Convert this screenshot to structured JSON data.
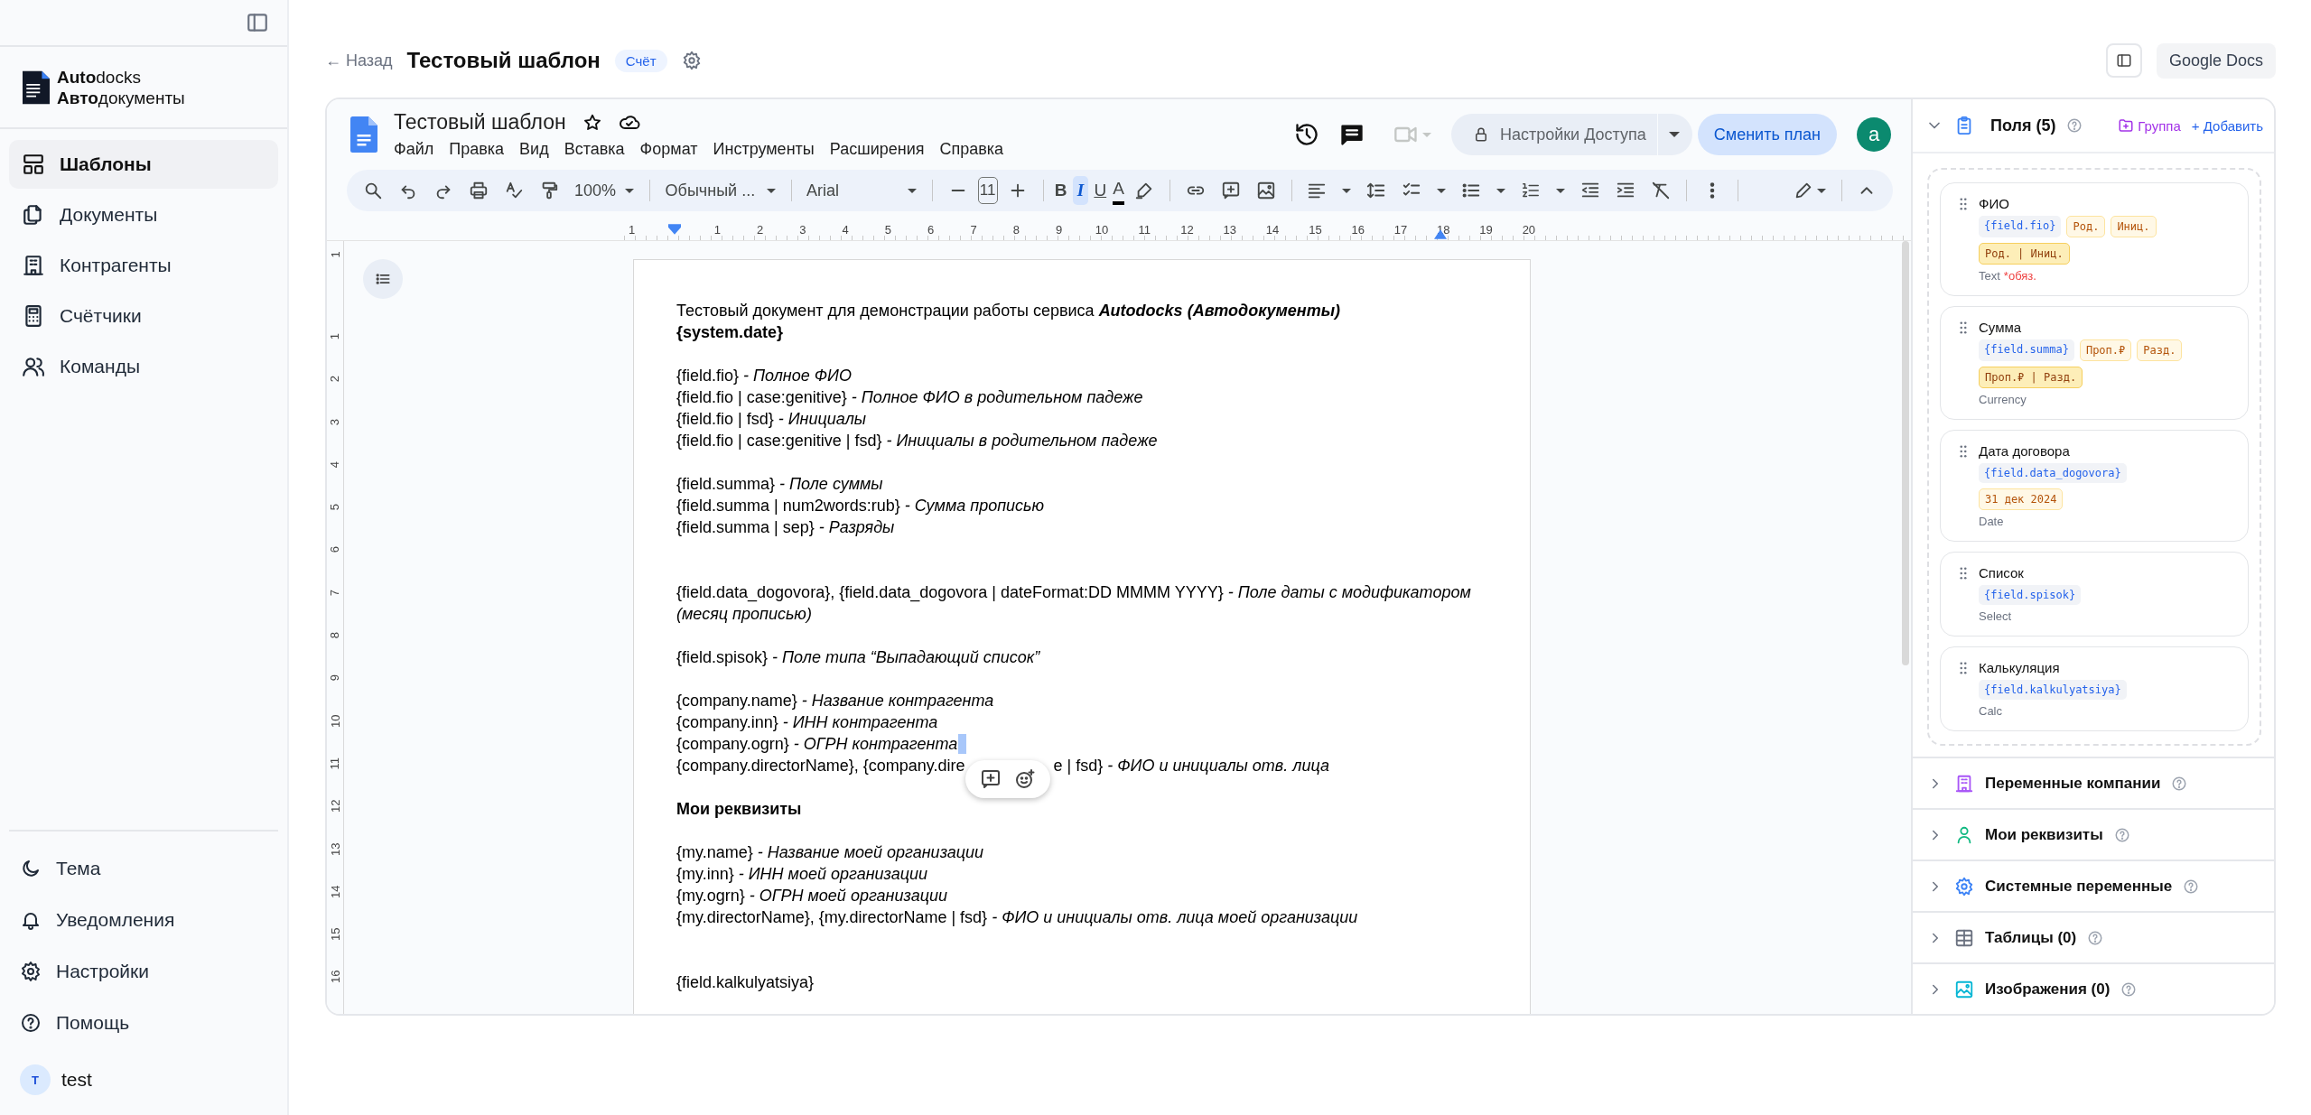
{
  "sidebar": {
    "brand": {
      "line_1": "**Auto**docks",
      "line_2": "**Авто**документы"
    },
    "nav": [
      {
        "label": "Шаблоны",
        "selected": true
      },
      {
        "label": "Документы",
        "selected": false
      },
      {
        "label": "Контрагенты",
        "selected": false
      },
      {
        "label": "Счётчики",
        "selected": false
      },
      {
        "label": "Команды",
        "selected": false
      }
    ],
    "footer": [
      {
        "label": "Тема"
      },
      {
        "label": "Уведомления"
      },
      {
        "label": "Настройки"
      },
      {
        "label": "Помощь"
      }
    ],
    "user": {
      "initial": "T",
      "name": "test"
    }
  },
  "header": {
    "back": "← Назад",
    "title": "Тестовый шаблон",
    "badge": "Счёт",
    "google_docs_button": "Google Docs"
  },
  "docs": {
    "title": "Тестовый шаблон",
    "menu": [
      "Файл",
      "Правка",
      "Вид",
      "Вставка",
      "Формат",
      "Инструменты",
      "Расширения",
      "Справка"
    ],
    "share_button": "Настройки Доступа",
    "plan_button": "Сменить план",
    "avatar": "a",
    "toolbar": {
      "zoom": "100%",
      "style": "Обычный ...",
      "font": "Arial",
      "font_size": "11",
      "format_buttons": [
        {
          "label": "B",
          "selected": false
        },
        {
          "label": "I",
          "selected": true
        },
        {
          "label": "U",
          "selected": false
        },
        {
          "label": "A",
          "selected": false
        }
      ]
    },
    "ruler_h": [
      "1",
      "1",
      "2",
      "3",
      "4",
      "5",
      "6",
      "7",
      "8",
      "9",
      "10",
      "11",
      "12",
      "13",
      "14",
      "15",
      "16",
      "17",
      "18",
      "19",
      "20"
    ],
    "ruler_v": [
      "1",
      "1",
      "2",
      "3",
      "4",
      "5",
      "6",
      "7",
      "8",
      "9",
      "10",
      "11",
      "12",
      "13",
      "14",
      "15",
      "16"
    ],
    "document": [
      {
        "kind": "intro",
        "text": "Тестовый документ для демонстрации работы сервиса *Autodocks (Автодокументы)*"
      },
      {
        "kind": "bold",
        "text": "{system.date}"
      },
      {
        "kind": "blank"
      },
      {
        "kind": "text",
        "text": "{field.fio} *- Полное ФИО*"
      },
      {
        "kind": "text",
        "text": "{field.fio | case:genitive} *- Полное ФИО в родительном падеже*"
      },
      {
        "kind": "text",
        "text": "{field.fio | fsd} *- Инициалы*"
      },
      {
        "kind": "text",
        "text": "{field.fio | case:genitive | fsd} *- Инициалы в родительном падеже*"
      },
      {
        "kind": "blank"
      },
      {
        "kind": "text",
        "text": "{field.summa} *- Поле суммы*"
      },
      {
        "kind": "text",
        "text": "{field.summa | num2words:rub} *- Сумма прописью*"
      },
      {
        "kind": "text",
        "text": "{field.summa | sep} *- Разряды*"
      },
      {
        "kind": "blank"
      },
      {
        "kind": "blank"
      },
      {
        "kind": "text",
        "text": "{field.data_dogovora}, {field.data_dogovora | dateFormat:DD MMMM YYYY} *- Поле даты с модификатором (месяц прописью)*"
      },
      {
        "kind": "blank"
      },
      {
        "kind": "text",
        "text": "{field.spisok} *- Поле типа “Выпадающий список”*"
      },
      {
        "kind": "blank"
      },
      {
        "kind": "text",
        "text": "{company.name} *- Название контрагента*"
      },
      {
        "kind": "text",
        "text": "{company.inn} *- ИНН контрагента*"
      },
      {
        "kind": "cursor",
        "text": "{company.ogrn} *- ОГРН контрагента*"
      },
      {
        "kind": "split",
        "before": "{company.directorName}, {company.dire",
        "after": "e | fsd} *- ФИО и инициалы отв. лица*"
      },
      {
        "kind": "blank"
      },
      {
        "kind": "bold",
        "text": "Мои реквизиты"
      },
      {
        "kind": "blank"
      },
      {
        "kind": "text",
        "text": "{my.name} *- Название моей организации*"
      },
      {
        "kind": "text",
        "text": "{my.inn} *- ИНН моей организации*"
      },
      {
        "kind": "text",
        "text": "{my.ogrn} *- ОГРН моей организации*"
      },
      {
        "kind": "text",
        "text": "{my.directorName}, {my.directorName | fsd} *- ФИО и инициалы отв. лица моей организации*"
      },
      {
        "kind": "blank"
      },
      {
        "kind": "blank"
      },
      {
        "kind": "text",
        "text": "{field.kalkulyatsiya}"
      }
    ]
  },
  "fields_panel": {
    "title": "Поля (5)",
    "expanded": true,
    "group_button": "Группа",
    "add_button": "+ Добавить",
    "fields": [
      {
        "name": "ФИО",
        "tags": [
          {
            "kind": "code",
            "text": "{field.fio}"
          },
          {
            "kind": "modifier",
            "text": "Род."
          },
          {
            "kind": "modifier",
            "text": "Иниц."
          },
          {
            "kind": "combo",
            "text": "Род. | Иниц."
          }
        ],
        "type": "Text",
        "required": "*обяз."
      },
      {
        "name": "Сумма",
        "tags": [
          {
            "kind": "code",
            "text": "{field.summa}"
          },
          {
            "kind": "modifier",
            "text": "Проп.₽"
          },
          {
            "kind": "modifier",
            "text": "Разд."
          },
          {
            "kind": "combo",
            "text": "Проп.₽ | Разд."
          }
        ],
        "type": "Currency"
      },
      {
        "name": "Дата договора",
        "tags": [
          {
            "kind": "code",
            "text": "{field.data_dogovora}"
          },
          {
            "kind": "modifier",
            "text": "31 дек 2024"
          }
        ],
        "type": "Date"
      },
      {
        "name": "Список",
        "tags": [
          {
            "kind": "code",
            "text": "{field.spisok}"
          }
        ],
        "type": "Select"
      },
      {
        "name": "Калькуляция",
        "tags": [
          {
            "kind": "code",
            "text": "{field.kalkulyatsiya}"
          }
        ],
        "type": "Calc"
      }
    ]
  },
  "sections": [
    {
      "title": "Переменные компании",
      "expanded": false
    },
    {
      "title": "Мои реквизиты",
      "expanded": false
    },
    {
      "title": "Системные переменные",
      "expanded": false
    },
    {
      "title": "Таблицы (0)",
      "expanded": false
    },
    {
      "title": "Изображения (0)",
      "expanded": false
    }
  ]
}
